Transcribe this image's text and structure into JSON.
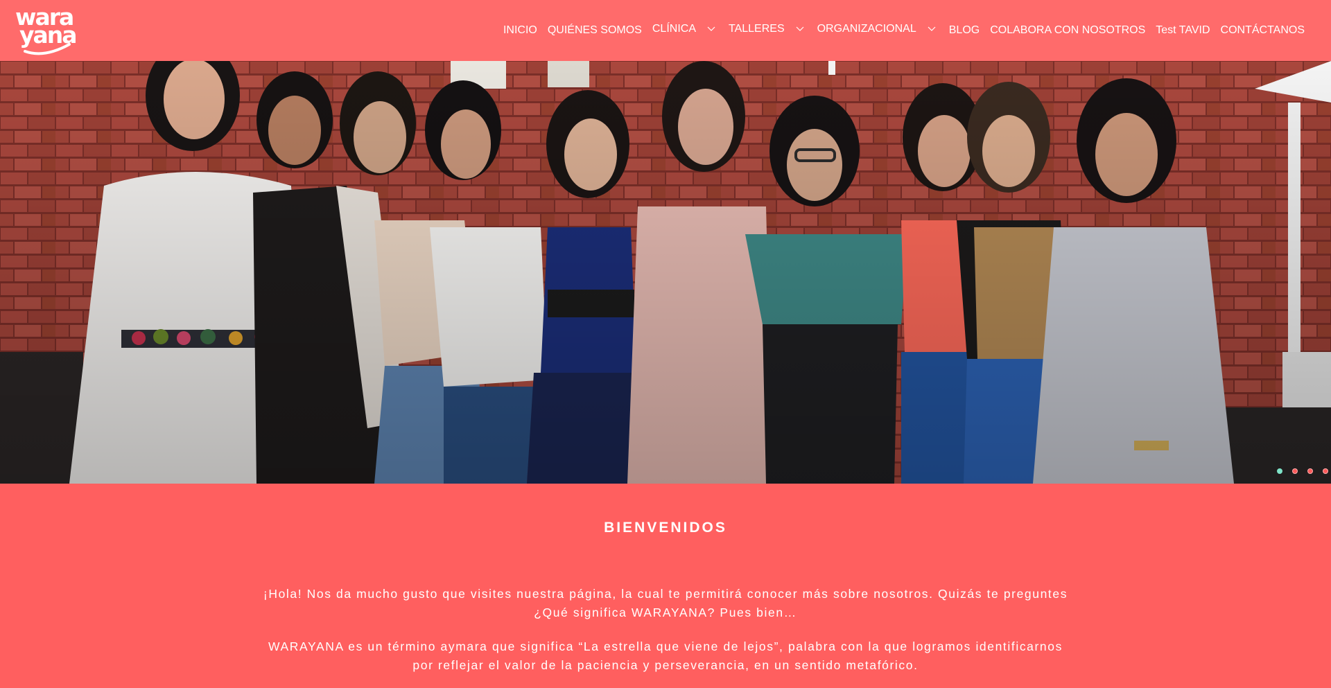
{
  "brand": {
    "logo_line1": "wara",
    "logo_line2": "yana"
  },
  "nav": {
    "items": [
      {
        "label": "INICIO",
        "dropdown": false
      },
      {
        "label": "QUIÉNES SOMOS",
        "dropdown": false
      },
      {
        "label": "CLÍNICA",
        "dropdown": true
      },
      {
        "label": "TALLERES",
        "dropdown": true
      },
      {
        "label": "ORGANIZACIONAL",
        "dropdown": true
      },
      {
        "label": "BLOG",
        "dropdown": false
      },
      {
        "label": "COLABORA CON NOSOTROS",
        "dropdown": false
      },
      {
        "label": "Test TAVID",
        "dropdown": false
      },
      {
        "label": "CONTÁCTANOS",
        "dropdown": false
      }
    ]
  },
  "hero": {
    "slide_count": 4,
    "active_slide": 1
  },
  "welcome": {
    "title": "BIENVENIDOS",
    "paragraph1": "¡Hola! Nos da mucho gusto que visites nuestra página, la cual te permitirá conocer más sobre nosotros. Quizás te preguntes ¿Qué significa WARAYANA? Pues bien…",
    "paragraph2": "WARAYANA es un término aymara que significa “La estrella que viene de lejos”, palabra con la que logramos identificarnos por reflejar el valor de la paciencia y perseverancia, en un sentido metafórico."
  },
  "colors": {
    "header_bg": "#ff6b6b",
    "section_bg": "#ff5f5f",
    "active_dot": "#7fe3c8",
    "text": "#ffffff"
  }
}
